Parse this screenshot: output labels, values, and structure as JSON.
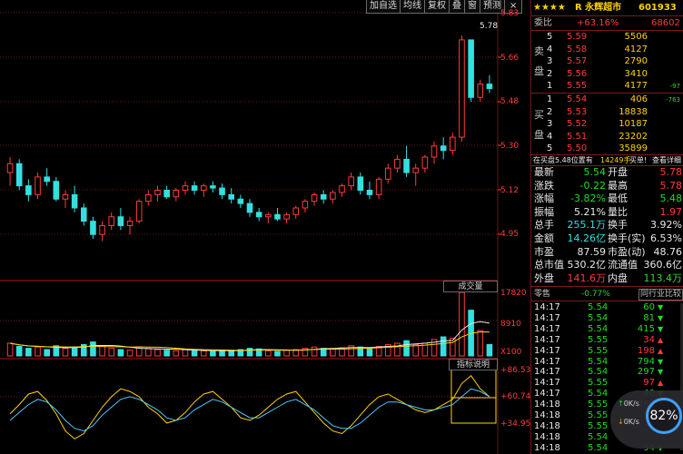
{
  "toolbar": {
    "buttons": [
      "加自选",
      "均线",
      "复权",
      "叠",
      "窗",
      "预测"
    ],
    "close": "×"
  },
  "price_axis": [
    "5.83",
    "5.66",
    "5.48",
    "5.30",
    "5.12",
    "4.95"
  ],
  "peak_label": "5.78",
  "volume": {
    "tag": "成交量",
    "axis": [
      "17820",
      "8910",
      "X100"
    ]
  },
  "indicator": {
    "tag": "指标说明",
    "axis": [
      "+86.53",
      "+60.74",
      "+34.95"
    ]
  },
  "header": {
    "stars": "★★★★",
    "name": "R 永辉超市",
    "code": "601933"
  },
  "weibi": {
    "label": "委比",
    "pct": "+63.16%",
    "value": "68602"
  },
  "sell": {
    "label": "卖盘",
    "levels": [
      {
        "n": "5",
        "price": "5.59",
        "vol": "5506"
      },
      {
        "n": "4",
        "price": "5.58",
        "vol": "4127"
      },
      {
        "n": "3",
        "price": "5.57",
        "vol": "2790"
      },
      {
        "n": "2",
        "price": "5.56",
        "vol": "3410"
      },
      {
        "n": "1",
        "price": "5.55",
        "vol": "4177",
        "chg": "-97"
      }
    ]
  },
  "buy": {
    "label": "买盘",
    "levels": [
      {
        "n": "1",
        "price": "5.54",
        "vol": "406",
        "chg": "-763"
      },
      {
        "n": "2",
        "price": "5.53",
        "vol": "18838"
      },
      {
        "n": "3",
        "price": "5.52",
        "vol": "10187"
      },
      {
        "n": "4",
        "price": "5.51",
        "vol": "23202"
      },
      {
        "n": "5",
        "price": "5.50",
        "vol": "35899"
      }
    ]
  },
  "info_bar": {
    "text1": "在买盘5.48位置有",
    "text2": "14249手",
    "text3": "买单!",
    "link": "查看详细"
  },
  "quote": [
    {
      "l1": "最新",
      "v1": "5.54",
      "c1": "green",
      "l2": "开盘",
      "v2": "5.78",
      "c2": "red"
    },
    {
      "l1": "涨跌",
      "v1": "-0.22",
      "c1": "green",
      "l2": "最高",
      "v2": "5.78",
      "c2": "red"
    },
    {
      "l1": "涨幅",
      "v1": "-3.82%",
      "c1": "green",
      "l2": "最低",
      "v2": "5.48",
      "c2": "green"
    },
    {
      "l1": "振幅",
      "v1": "5.21%",
      "c1": "white",
      "l2": "量比",
      "v2": "1.97",
      "c2": "red"
    },
    {
      "l1": "总手",
      "v1": "255.1万",
      "c1": "cyan",
      "l2": "换手",
      "v2": "3.92%",
      "c2": "white"
    },
    {
      "l1": "金额",
      "v1": "14.26亿",
      "c1": "cyan",
      "l2": "换手(实)",
      "v2": "6.53%",
      "c2": "white"
    },
    {
      "l1": "市盈",
      "v1": "87.59",
      "c1": "white",
      "l2": "市盈(动)",
      "v2": "48.76",
      "c2": "white"
    },
    {
      "l1": "总市值",
      "v1": "530.2亿",
      "c1": "white",
      "l2": "流通值",
      "v2": "360.6亿",
      "c2": "white"
    },
    {
      "l1": "外盘",
      "v1": "141.6万",
      "c1": "red",
      "l2": "内盘",
      "v2": "113.4万",
      "c2": "green"
    }
  ],
  "sector": {
    "label": "零售",
    "pct": "-0.77%",
    "compare": "同行业比较"
  },
  "ticks": [
    {
      "time": "14:17",
      "price": "5.54",
      "vol": "60",
      "dir": "down"
    },
    {
      "time": "14:17",
      "price": "5.54",
      "vol": "81",
      "dir": "down"
    },
    {
      "time": "14:17",
      "price": "5.54",
      "vol": "415",
      "dir": "down"
    },
    {
      "time": "14:17",
      "price": "5.55",
      "vol": "34",
      "dir": "up"
    },
    {
      "time": "14:17",
      "price": "5.55",
      "vol": "198",
      "dir": "up"
    },
    {
      "time": "14:17",
      "price": "5.54",
      "vol": "794",
      "dir": "down"
    },
    {
      "time": "14:17",
      "price": "5.54",
      "vol": "297",
      "dir": "down"
    },
    {
      "time": "14:17",
      "price": "5.55",
      "vol": "97",
      "dir": "up"
    },
    {
      "time": "14:17",
      "price": "5.54",
      "vol": "40",
      "dir": "down"
    },
    {
      "time": "14:18",
      "price": "5.55",
      "vol": "260",
      "dir": "up"
    },
    {
      "time": "14:18",
      "price": "5.55",
      "vol": "",
      "dir": ""
    },
    {
      "time": "14:18",
      "price": "5.55",
      "vol": "",
      "dir": ""
    },
    {
      "time": "14:18",
      "price": "5.54",
      "vol": "",
      "dir": ""
    },
    {
      "time": "14:18",
      "price": "5.54",
      "vol": "94",
      "dir": "down"
    }
  ],
  "badge": {
    "pct": "82%",
    "up": "0K/s",
    "down": "0K/s"
  },
  "colors": {
    "up": "#ff3b3b",
    "down": "#33e0e0",
    "ma_white": "#e8e8e8",
    "ma_yellow": "#ffd200",
    "grid": "#6a1a1a"
  },
  "chart_data": {
    "type": "candlestick",
    "y_range": [
      4.86,
      5.87
    ],
    "candles": [
      [
        5.18,
        5.25,
        5.12,
        5.22
      ],
      [
        5.22,
        5.24,
        5.1,
        5.12
      ],
      [
        5.12,
        5.15,
        5.05,
        5.08
      ],
      [
        5.08,
        5.18,
        5.06,
        5.16
      ],
      [
        5.16,
        5.2,
        5.12,
        5.14
      ],
      [
        5.14,
        5.16,
        5.05,
        5.06
      ],
      [
        5.06,
        5.1,
        5.02,
        5.08
      ],
      [
        5.08,
        5.12,
        5.0,
        5.02
      ],
      [
        5.02,
        5.04,
        4.94,
        4.96
      ],
      [
        4.96,
        4.98,
        4.88,
        4.9
      ],
      [
        4.9,
        4.96,
        4.87,
        4.94
      ],
      [
        4.94,
        5.0,
        4.92,
        4.98
      ],
      [
        4.98,
        5.02,
        4.92,
        4.94
      ],
      [
        4.94,
        4.98,
        4.9,
        4.96
      ],
      [
        4.96,
        5.06,
        4.95,
        5.05
      ],
      [
        5.05,
        5.1,
        5.03,
        5.08
      ],
      [
        5.08,
        5.12,
        5.05,
        5.1
      ],
      [
        5.1,
        5.12,
        5.06,
        5.07
      ],
      [
        5.07,
        5.11,
        5.05,
        5.1
      ],
      [
        5.1,
        5.14,
        5.08,
        5.12
      ],
      [
        5.12,
        5.14,
        5.08,
        5.1
      ],
      [
        5.1,
        5.13,
        5.07,
        5.12
      ],
      [
        5.12,
        5.14,
        5.09,
        5.11
      ],
      [
        5.11,
        5.13,
        5.06,
        5.08
      ],
      [
        5.08,
        5.11,
        5.04,
        5.06
      ],
      [
        5.06,
        5.08,
        5.02,
        5.04
      ],
      [
        5.04,
        5.06,
        4.98,
        5.0
      ],
      [
        5.0,
        5.02,
        4.96,
        4.98
      ],
      [
        4.98,
        5.0,
        4.95,
        4.99
      ],
      [
        4.99,
        5.02,
        4.96,
        4.97
      ],
      [
        4.97,
        5.0,
        4.95,
        4.99
      ],
      [
        4.99,
        5.03,
        4.97,
        5.02
      ],
      [
        5.02,
        5.06,
        5.0,
        5.05
      ],
      [
        5.05,
        5.09,
        5.03,
        5.08
      ],
      [
        5.08,
        5.1,
        5.04,
        5.06
      ],
      [
        5.06,
        5.1,
        5.04,
        5.09
      ],
      [
        5.09,
        5.13,
        5.07,
        5.12
      ],
      [
        5.12,
        5.18,
        5.1,
        5.16
      ],
      [
        5.16,
        5.18,
        5.08,
        5.1
      ],
      [
        5.1,
        5.14,
        5.06,
        5.08
      ],
      [
        5.08,
        5.16,
        5.06,
        5.15
      ],
      [
        5.15,
        5.22,
        5.13,
        5.2
      ],
      [
        5.2,
        5.26,
        5.18,
        5.24
      ],
      [
        5.24,
        5.3,
        5.16,
        5.18
      ],
      [
        5.18,
        5.22,
        5.12,
        5.2
      ],
      [
        5.2,
        5.26,
        5.18,
        5.25
      ],
      [
        5.25,
        5.32,
        5.22,
        5.3
      ],
      [
        5.3,
        5.34,
        5.24,
        5.28
      ],
      [
        5.28,
        5.36,
        5.26,
        5.34
      ],
      [
        5.34,
        5.8,
        5.32,
        5.78
      ],
      [
        5.78,
        5.78,
        5.5,
        5.52
      ],
      [
        5.52,
        5.6,
        5.5,
        5.58
      ],
      [
        5.58,
        5.62,
        5.54,
        5.56
      ]
    ],
    "volume": [
      20,
      15,
      12,
      14,
      10,
      16,
      12,
      14,
      18,
      22,
      16,
      12,
      10,
      9,
      14,
      12,
      10,
      9,
      8,
      10,
      9,
      8,
      7,
      8,
      9,
      10,
      12,
      11,
      8,
      7,
      9,
      10,
      12,
      14,
      12,
      11,
      13,
      16,
      14,
      12,
      15,
      18,
      20,
      24,
      18,
      20,
      26,
      30,
      28,
      100,
      72,
      40,
      18
    ],
    "oscillator": {
      "yellow": [
        55,
        62,
        70,
        72,
        65,
        55,
        42,
        36,
        40,
        50,
        60,
        68,
        74,
        72,
        68,
        60,
        55,
        48,
        50,
        56,
        64,
        70,
        72,
        66,
        60,
        52,
        50,
        54,
        60,
        66,
        70,
        72,
        64,
        56,
        48,
        42,
        40,
        46,
        54,
        62,
        68,
        70,
        66,
        62,
        58,
        56,
        58,
        62,
        66,
        78,
        84,
        74,
        68
      ],
      "cyan": [
        50,
        56,
        62,
        66,
        64,
        58,
        50,
        44,
        42,
        46,
        54,
        60,
        66,
        68,
        66,
        62,
        58,
        52,
        50,
        52,
        58,
        62,
        66,
        64,
        60,
        56,
        52,
        52,
        56,
        60,
        64,
        66,
        62,
        58,
        52,
        46,
        44,
        44,
        48,
        54,
        60,
        64,
        64,
        62,
        60,
        58,
        58,
        60,
        62,
        68,
        74,
        72,
        68
      ]
    }
  }
}
